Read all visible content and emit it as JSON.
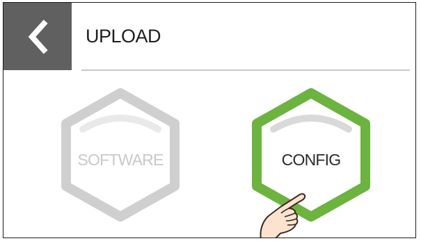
{
  "header": {
    "title": "UPLOAD",
    "back_icon": "chevron-left-icon"
  },
  "options": [
    {
      "label": "SOFTWARE",
      "state": "disabled",
      "outline_color": "#cfcfcf"
    },
    {
      "label": "CONFIG",
      "state": "active",
      "outline_color": "#6cb33f"
    }
  ],
  "colors": {
    "back_button_bg": "#606060",
    "accent_green": "#6cb33f",
    "disabled_gray": "#cfcfcf"
  },
  "pointer_icon": "tap-hand-icon"
}
